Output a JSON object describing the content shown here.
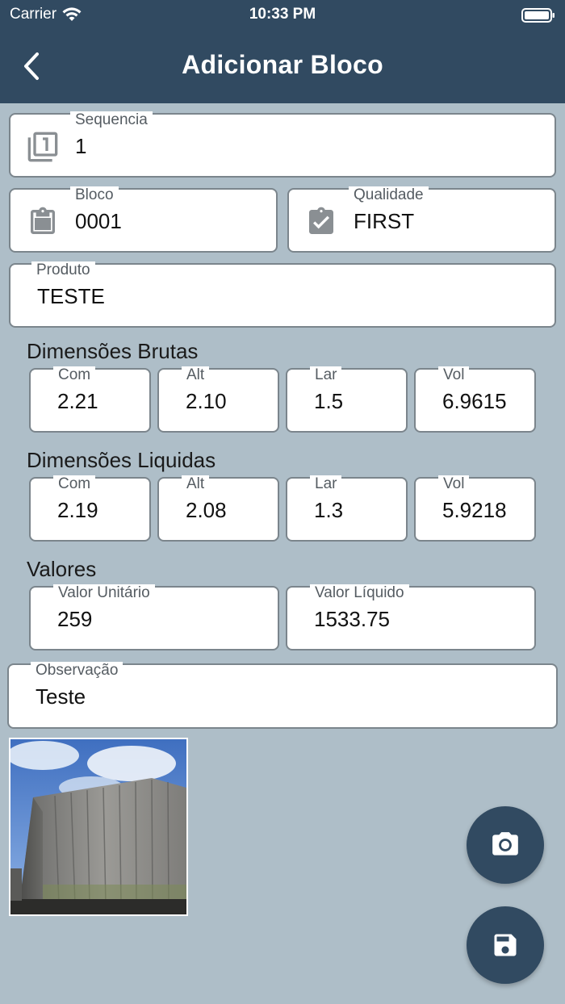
{
  "status_bar": {
    "carrier": "Carrier",
    "time": "10:33 PM"
  },
  "header": {
    "title": "Adicionar Bloco"
  },
  "sequencia": {
    "label": "Sequencia",
    "value": "1"
  },
  "bloco": {
    "label": "Bloco",
    "value": "0001"
  },
  "qualidade": {
    "label": "Qualidade",
    "value": "FIRST"
  },
  "produto": {
    "label": "Produto",
    "value": "TESTE"
  },
  "dimensoes_brutas": {
    "title": "Dimensões Brutas",
    "com": {
      "label": "Com",
      "value": "2.21"
    },
    "alt": {
      "label": "Alt",
      "value": "2.10"
    },
    "lar": {
      "label": "Lar",
      "value": "1.5"
    },
    "vol": {
      "label": "Vol",
      "value": "6.9615"
    }
  },
  "dimensoes_liquidas": {
    "title": "Dimensões Liquidas",
    "com": {
      "label": "Com",
      "value": "2.19"
    },
    "alt": {
      "label": "Alt",
      "value": "2.08"
    },
    "lar": {
      "label": "Lar",
      "value": "1.3"
    },
    "vol": {
      "label": "Vol",
      "value": "5.9218"
    }
  },
  "valores": {
    "title": "Valores",
    "unitario": {
      "label": "Valor Unitário",
      "value": "259"
    },
    "liquido": {
      "label": "Valor Líquido",
      "value": "1533.75"
    }
  },
  "observacao": {
    "label": "Observação",
    "value": "Teste"
  },
  "icons": {
    "back": "chevron-left-icon",
    "sequencia": "filter-1-icon",
    "bloco": "clipboard-icon",
    "qualidade": "assignment-check-icon",
    "camera": "camera-icon",
    "save": "save-icon"
  },
  "colors": {
    "header_bg": "#314a61",
    "page_bg": "#aebec8",
    "field_border": "#7b858c",
    "fab_bg": "#314a61"
  }
}
